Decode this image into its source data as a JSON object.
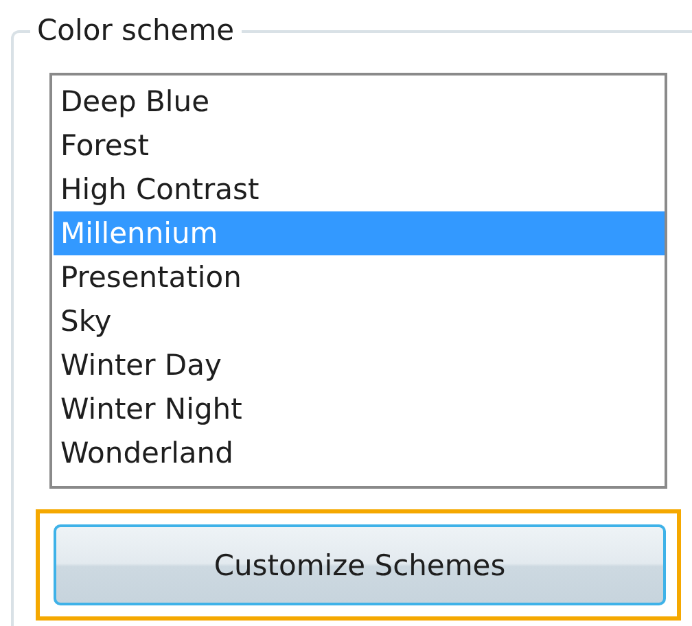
{
  "group": {
    "title": "Color scheme"
  },
  "schemes": [
    {
      "label": "Deep Blue",
      "selected": false
    },
    {
      "label": "Forest",
      "selected": false
    },
    {
      "label": "High Contrast",
      "selected": false
    },
    {
      "label": "Millennium",
      "selected": true
    },
    {
      "label": "Presentation",
      "selected": false
    },
    {
      "label": "Sky",
      "selected": false
    },
    {
      "label": "Winter Day",
      "selected": false
    },
    {
      "label": "Winter Night",
      "selected": false
    },
    {
      "label": "Wonderland",
      "selected": false
    }
  ],
  "button": {
    "label": "Customize Schemes",
    "highlighted": true
  }
}
